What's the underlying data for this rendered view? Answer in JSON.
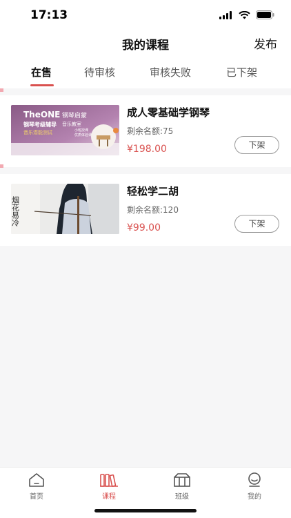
{
  "status_bar": {
    "time": "17:13"
  },
  "nav": {
    "title": "我的课程",
    "publish_label": "发布"
  },
  "tabs": [
    {
      "label": "在售"
    },
    {
      "label": "待审核"
    },
    {
      "label": "审核失败"
    },
    {
      "label": "已下架"
    }
  ],
  "active_tab": "在售",
  "courses": [
    {
      "title": "成人零基础学钢琴",
      "remaining": "剩余名额:75",
      "price": "¥198.00",
      "action_label": "下架",
      "thumbnail": {
        "brand": "TheONE",
        "title_line": "钢琴启蒙",
        "line1": "钢琴考级辅导",
        "line2": "音乐教室",
        "line3": "音乐潜能测试",
        "line4": "小班授课",
        "line5": "优质体验课"
      }
    },
    {
      "title": "轻松学二胡",
      "remaining": "剩余名额:120",
      "price": "¥99.00",
      "action_label": "下架",
      "thumbnail": {
        "calligraphy": "烟花易冷"
      }
    }
  ],
  "tabbar": [
    {
      "label": "首页",
      "icon": "home-icon"
    },
    {
      "label": "课程",
      "icon": "books-icon"
    },
    {
      "label": "班级",
      "icon": "class-icon"
    },
    {
      "label": "我的",
      "icon": "profile-icon"
    }
  ],
  "colors": {
    "accent": "#d9514f",
    "background": "#f6f6f7"
  }
}
